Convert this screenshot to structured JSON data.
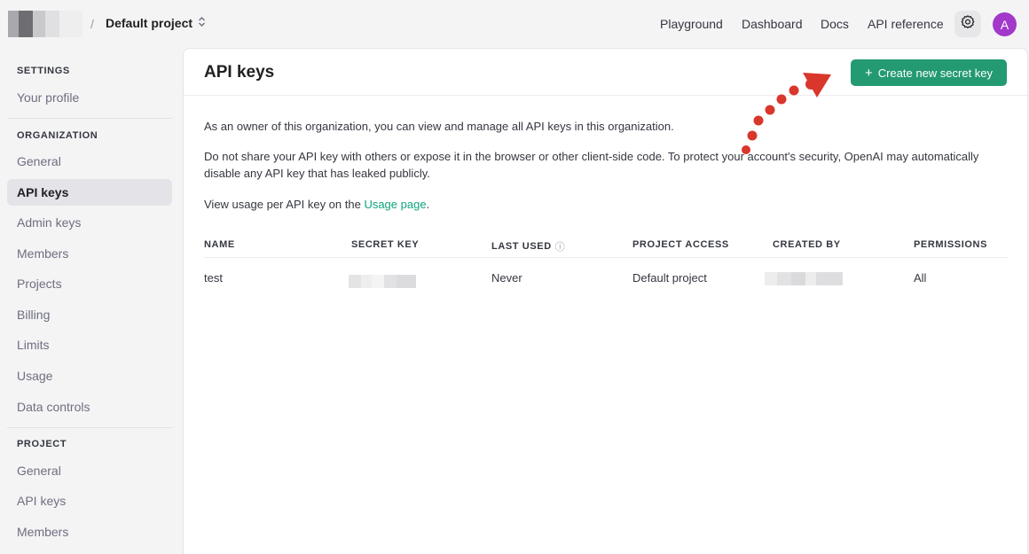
{
  "topbar": {
    "separator": "/",
    "project_name": "Default project",
    "project_chevron": "⌃⌄",
    "nav": [
      "Playground",
      "Dashboard",
      "Docs",
      "API reference"
    ],
    "settings_icon": "gear-icon",
    "avatar_initial": "A",
    "avatar_color": "#a239ca"
  },
  "sidebar": {
    "settings_heading": "SETTINGS",
    "your_profile": "Your profile",
    "organization_heading": "ORGANIZATION",
    "org_items": [
      "General",
      "API keys",
      "Admin keys",
      "Members",
      "Projects",
      "Billing",
      "Limits",
      "Usage",
      "Data controls"
    ],
    "active_item": "API keys",
    "project_heading": "PROJECT",
    "project_items": [
      "General",
      "API keys",
      "Members"
    ]
  },
  "main": {
    "title": "API keys",
    "create_button_icon": "+",
    "create_button_label": "Create new secret key",
    "para1": "As an owner of this organization, you can view and manage all API keys in this organization.",
    "para2": "Do not share your API key with others or expose it in the browser or other client-side code. To protect your account's security, OpenAI may automatically disable any API key that has leaked publicly.",
    "para3_prefix": "View usage per API key on the ",
    "para3_link": "Usage page",
    "para3_suffix": ".",
    "table": {
      "headers": [
        "NAME",
        "SECRET KEY",
        "LAST USED",
        "PROJECT ACCESS",
        "CREATED BY",
        "PERMISSIONS"
      ],
      "info_icon": "ⓘ",
      "rows": [
        {
          "name": "test",
          "last_used": "Never",
          "project_access": "Default project",
          "permissions": "All"
        }
      ]
    }
  },
  "colors": {
    "accent": "#239a72",
    "link": "#10a37f",
    "annotation": "#d9362c"
  }
}
